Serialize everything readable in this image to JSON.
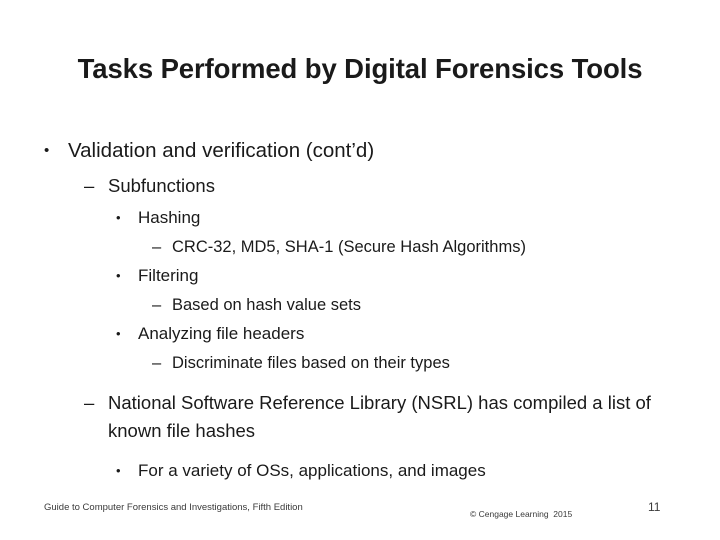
{
  "slide": {
    "title": "Tasks Performed by Digital Forensics Tools",
    "background_color": "#ffffff",
    "text_color": "#1a1a1a"
  },
  "markers": {
    "bullet": "•",
    "dash": "–"
  },
  "content": {
    "items": [
      {
        "level": 1,
        "marker": "bullet",
        "text": "Validation and verification (cont’d)"
      },
      {
        "level": 2,
        "marker": "dash",
        "text": "Subfunctions"
      },
      {
        "level": 3,
        "marker": "bullet",
        "text": "Hashing"
      },
      {
        "level": 4,
        "marker": "dash",
        "text": "CRC-32, MD5, SHA-1 (Secure Hash Algorithms)"
      },
      {
        "level": 3,
        "marker": "bullet",
        "text": "Filtering"
      },
      {
        "level": 4,
        "marker": "dash",
        "text": "Based on hash value sets"
      },
      {
        "level": 3,
        "marker": "bullet",
        "text": "Analyzing file headers"
      },
      {
        "level": 4,
        "marker": "dash",
        "text": "Discriminate files based on their types"
      },
      {
        "level": 2,
        "marker": "dash",
        "text": "National Software Reference Library (NSRL) has compiled a list of known file hashes"
      },
      {
        "level": 3,
        "marker": "bullet",
        "text": "For a variety of OSs, applications, and images"
      }
    ]
  },
  "footer": {
    "source": "Guide to Computer Forensics and Investigations, Fifth Edition",
    "copyright": "© Cengage Learning  2015",
    "slide_number": "11"
  }
}
